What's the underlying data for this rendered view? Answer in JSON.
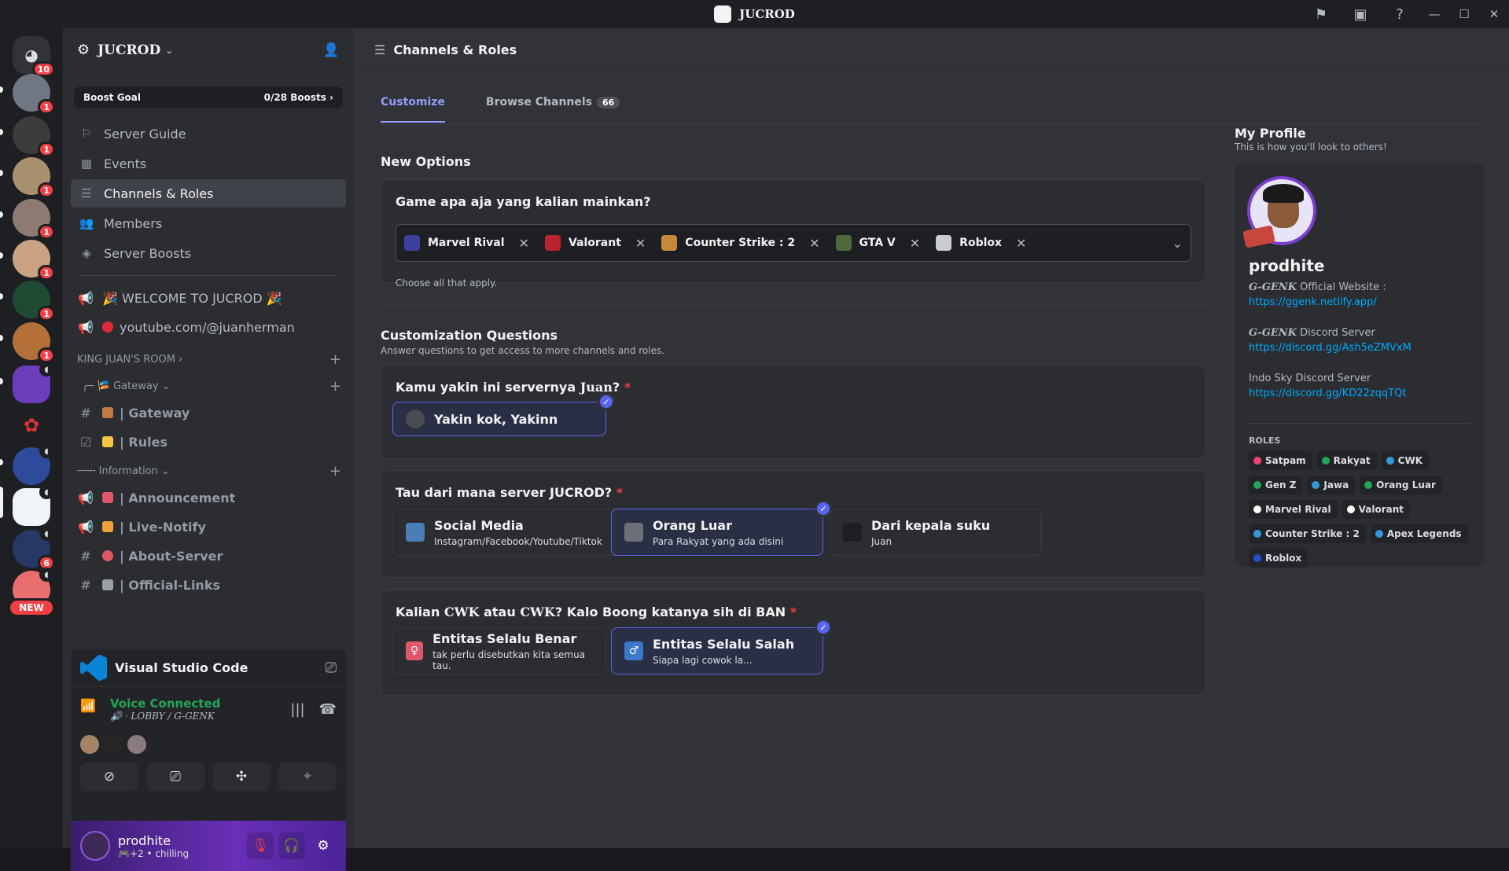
{
  "window": {
    "title": "JUCROD"
  },
  "rail": {
    "home_badge": "10",
    "new_label": "NEW",
    "servers": [
      {
        "badge": "1"
      },
      {
        "badge": "1"
      },
      {
        "badge": "1"
      },
      {
        "badge": "1"
      },
      {
        "badge": "1"
      },
      {
        "badge": "1"
      },
      {
        "badge": "1"
      },
      {
        "badge": ""
      },
      {
        "badge": ""
      },
      {
        "badge": ""
      },
      {
        "badge": ""
      },
      {
        "badge": "6"
      },
      {
        "badge": ""
      }
    ]
  },
  "sidebar": {
    "server_name": "JUCROD",
    "boost": {
      "label": "Boost Goal",
      "value": "0/28 Boosts"
    },
    "nav": [
      {
        "label": "Server Guide",
        "icon": "signpost-icon"
      },
      {
        "label": "Events",
        "icon": "calendar-icon"
      },
      {
        "label": "Channels & Roles",
        "icon": "channels-roles-icon"
      },
      {
        "label": "Members",
        "icon": "members-icon"
      },
      {
        "label": "Server Boosts",
        "icon": "boost-icon"
      }
    ],
    "pinned": [
      {
        "label": "🎉 WELCOME TO JUCROD 🎉"
      },
      {
        "label": "youtube.com/@juanherman"
      }
    ],
    "cat_king": "KING JUAN'S ROOM",
    "cat_gateway": "Gateway",
    "gateway_channels": [
      {
        "label": "| Gateway"
      },
      {
        "label": "| Rules"
      }
    ],
    "cat_info": "Information",
    "info_channels": [
      {
        "label": "| Announcement"
      },
      {
        "label": "| Live-Notify"
      },
      {
        "label": "| About-Server"
      },
      {
        "label": "| Official-Links"
      }
    ]
  },
  "activity": {
    "app": "Visual Studio Code",
    "voice_status": "Voice Connected",
    "voice_channel": "LOBBY / G-GENK"
  },
  "user": {
    "name": "prodhite",
    "status": "chilling",
    "extra": "+2"
  },
  "main": {
    "header": "Channels & Roles",
    "tabs": [
      {
        "label": "Customize"
      },
      {
        "label": "Browse Channels",
        "count": "66"
      }
    ],
    "new_options_title": "New Options",
    "q1": {
      "question": "Game apa aja yang kalian mainkan?",
      "tags": [
        "Marvel Rival",
        "Valorant",
        "Counter Strike : 2",
        "GTA V",
        "Roblox"
      ],
      "hint": "Choose all that apply."
    },
    "cq_title": "Customization Questions",
    "cq_sub": "Answer questions to get access to more channels and roles.",
    "q2": {
      "q_pre": "Kamu yakin ini servernya ",
      "q_em": "Juan",
      "q_post": "?",
      "options": [
        {
          "title": "Yakin kok, Yakinn",
          "sub": ""
        }
      ]
    },
    "q3": {
      "question": "Tau dari mana server JUCROD?",
      "options": [
        {
          "title": "Social Media",
          "sub": "Instagram/Facebook/Youtube/Tiktok"
        },
        {
          "title": "Orang Luar",
          "sub": "Para Rakyat yang ada disini"
        },
        {
          "title": "Dari kepala suku",
          "sub": "Juan"
        }
      ]
    },
    "q4": {
      "q_pre": "Kalian ",
      "q_em1": "CWK",
      "q_mid": " atau ",
      "q_em2": "CWK",
      "q_post": "? Kalo Boong katanya sih di BAN",
      "options": [
        {
          "title": "Entitas Selalu Benar",
          "sub": "tak perlu disebutkan kita semua tau."
        },
        {
          "title": "Entitas Selalu Salah",
          "sub": "Siapa lagi cowok la..."
        }
      ]
    },
    "required_mark": "*"
  },
  "profile": {
    "title": "My Profile",
    "sub": "This is how you'll look to others!",
    "name": "prodhite",
    "bio1_em": "G-GENK",
    "bio1": " Official Website :",
    "link1": "https://ggenk.netlify.app/",
    "bio2_em": "G-GENK",
    "bio2": " Discord Server",
    "link2": "https://discord.gg/Ash5eZMVxM",
    "bio3": "Indo Sky Discord Server",
    "link3": "https://discord.gg/KD22zqqTQt",
    "roles_header": "ROLES",
    "roles": [
      {
        "name": "Satpam",
        "color": "#f23f73"
      },
      {
        "name": "Rakyat",
        "color": "#23a55a"
      },
      {
        "name": "CWK",
        "color": "#3498db"
      },
      {
        "name": "Gen Z",
        "color": "#23a55a"
      },
      {
        "name": "Jawa",
        "color": "#3498db"
      },
      {
        "name": "Orang Luar",
        "color": "#23a55a"
      },
      {
        "name": "Marvel Rival",
        "color": "#ffffff"
      },
      {
        "name": "Valorant",
        "color": "#ffffff"
      },
      {
        "name": "Counter Strike : 2",
        "color": "#3498db"
      },
      {
        "name": "Apex Legends",
        "color": "#3498db"
      },
      {
        "name": "Roblox",
        "color": "#1f4fcf"
      }
    ]
  },
  "colors": {
    "accent": "#5865f2",
    "danger": "#f23f43",
    "success": "#23a55a",
    "link": "#00a8fc"
  }
}
